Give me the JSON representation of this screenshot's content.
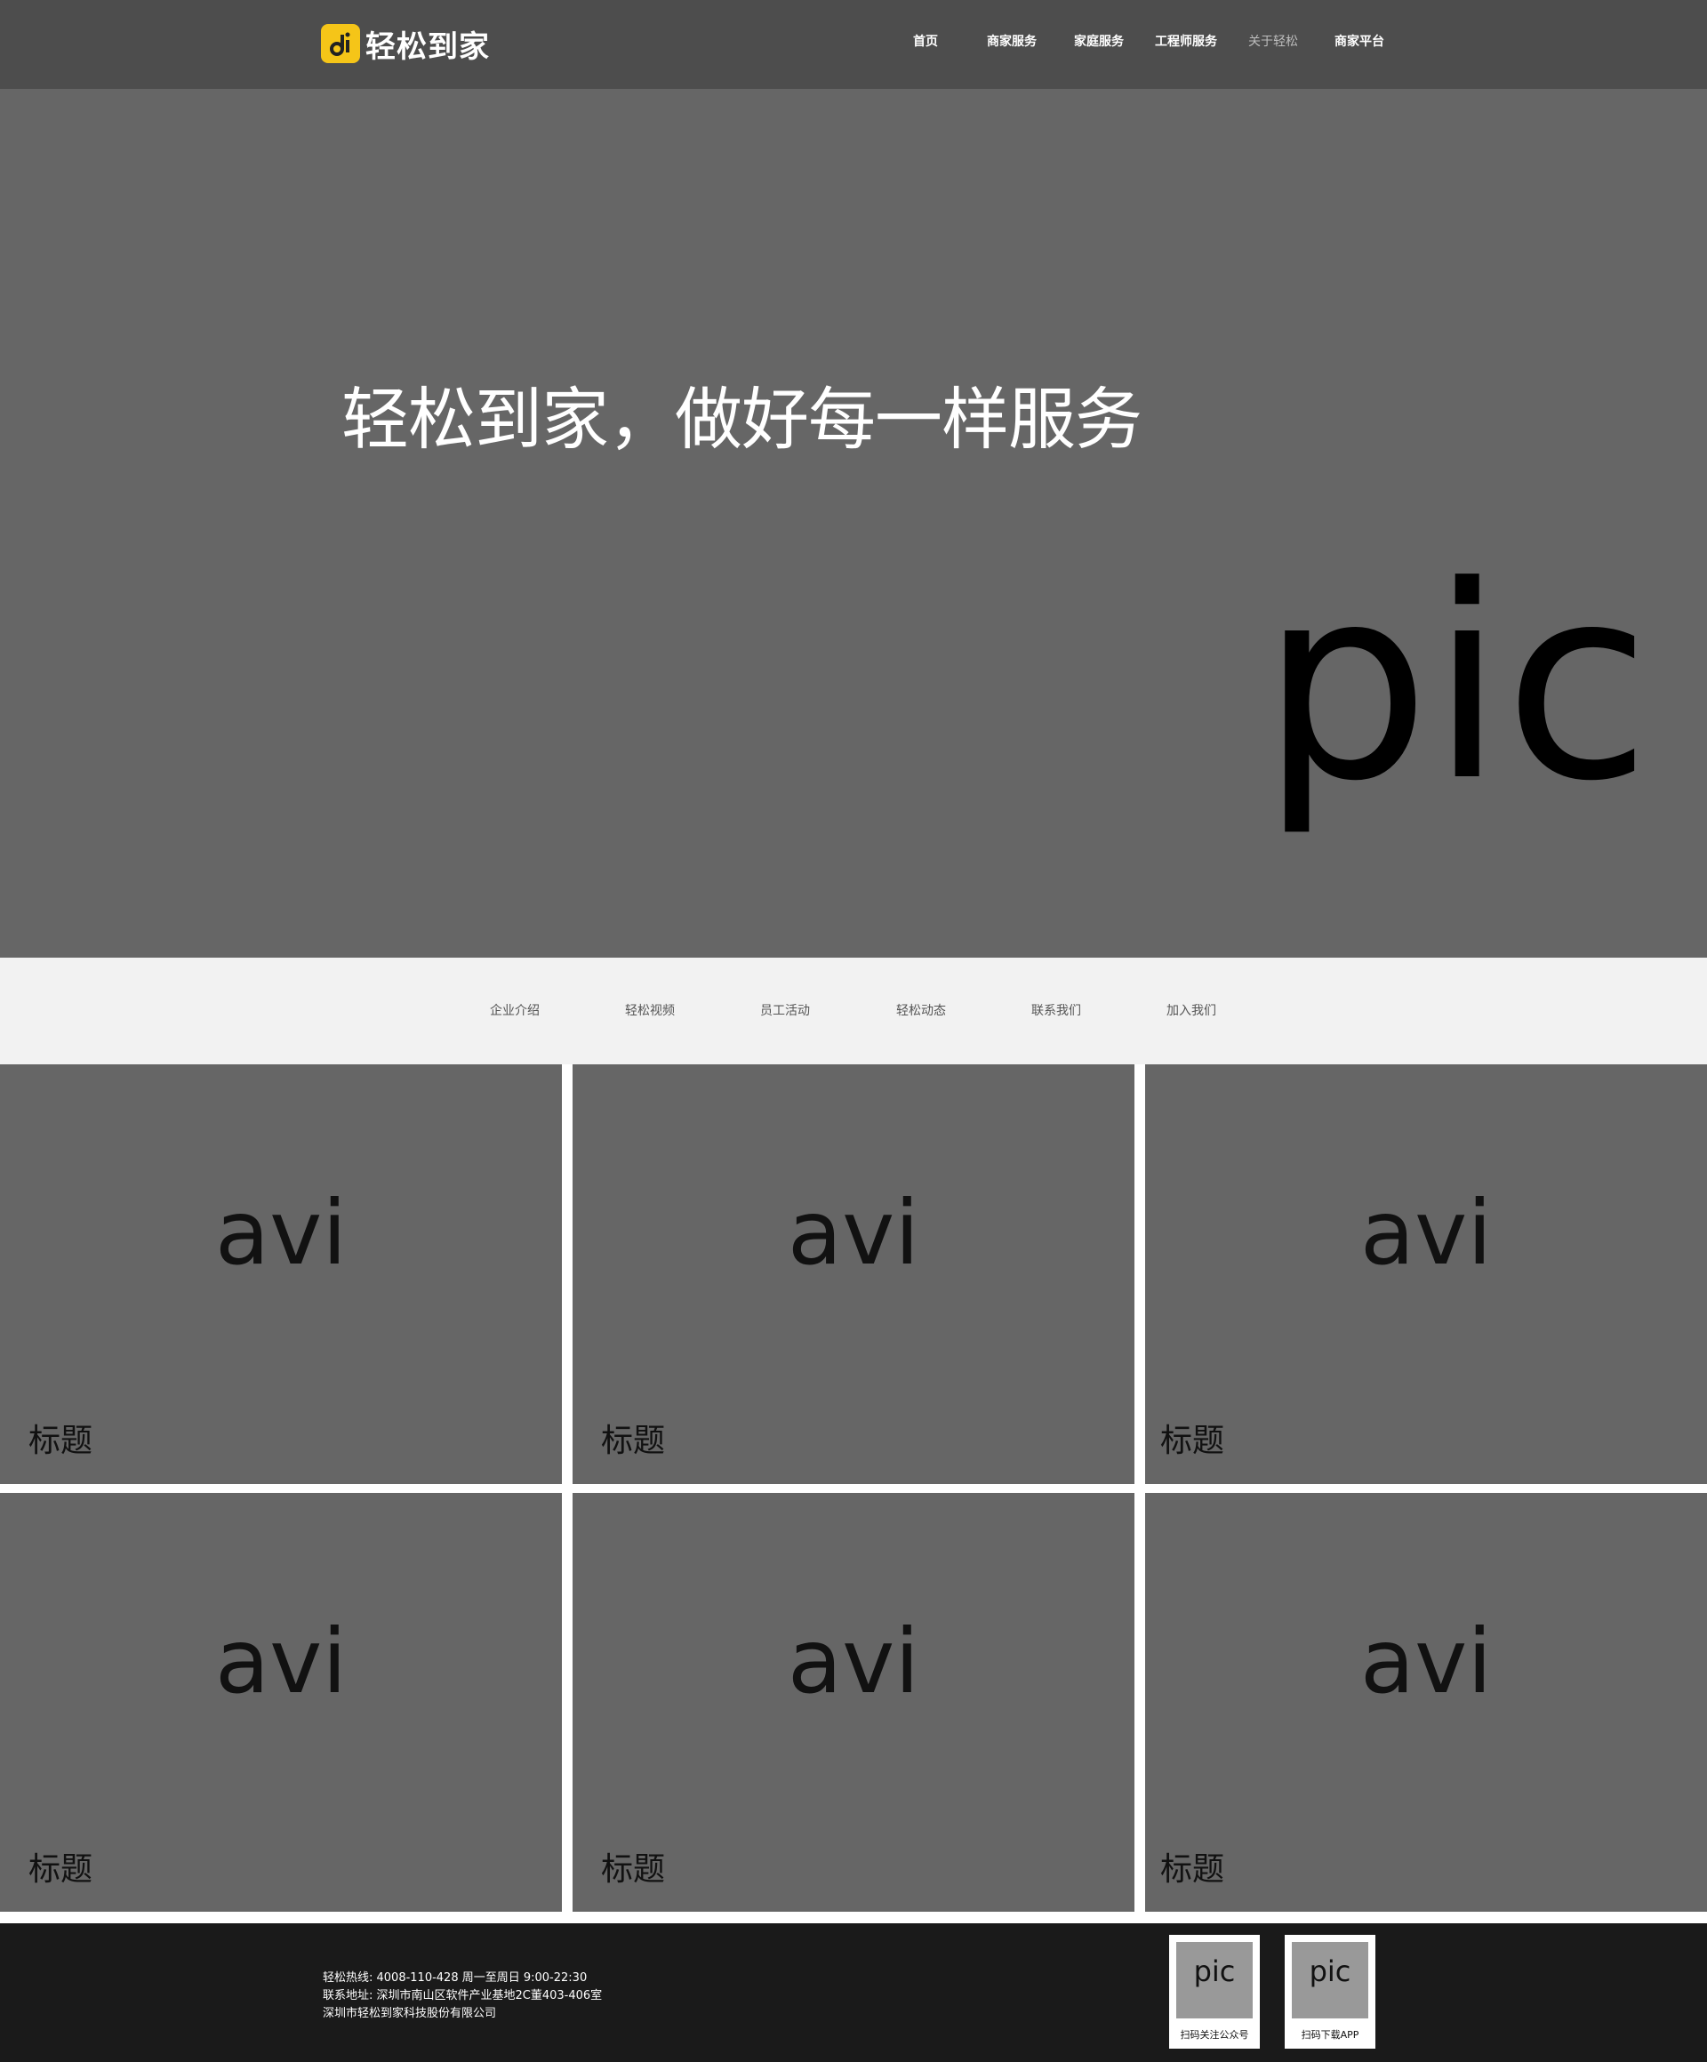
{
  "brand": {
    "name": "轻松到家",
    "accent": "#f5c518"
  },
  "nav": {
    "items": [
      "首页",
      "商家服务",
      "家庭服务",
      "工程师服务",
      "关于轻松",
      "商家平台"
    ],
    "active": "关于轻松"
  },
  "hero": {
    "title": "轻松到家，做好每一样服务",
    "image_placeholder": "pic"
  },
  "subnav": {
    "items": [
      "企业介绍",
      "轻松视频",
      "员工活动",
      "轻松动态",
      "联系我们",
      "加入我们"
    ]
  },
  "videos": [
    {
      "placeholder": "avi",
      "title": "标题"
    },
    {
      "placeholder": "avi",
      "title": "标题"
    },
    {
      "placeholder": "avi",
      "title": "标题"
    },
    {
      "placeholder": "avi",
      "title": "标题"
    },
    {
      "placeholder": "avi",
      "title": "标题"
    },
    {
      "placeholder": "avi",
      "title": "标题"
    }
  ],
  "footer": {
    "hotline": "轻松热线: 4008-110-428  周一至周日 9:00-22:30",
    "address": "联系地址: 深圳市南山区软件产业基地2C董403-406室",
    "company": "深圳市轻松到家科技股份有限公司",
    "qr_codes": [
      {
        "placeholder": "pic",
        "label": "扫码关注公众号"
      },
      {
        "placeholder": "pic",
        "label": "扫码下载APP"
      }
    ]
  },
  "colors": {
    "header_bg": "#4d4d4d",
    "placeholder_bg": "#666666",
    "subnav_bg": "#f2f2f2",
    "footer_bg": "#1a1a1a"
  }
}
